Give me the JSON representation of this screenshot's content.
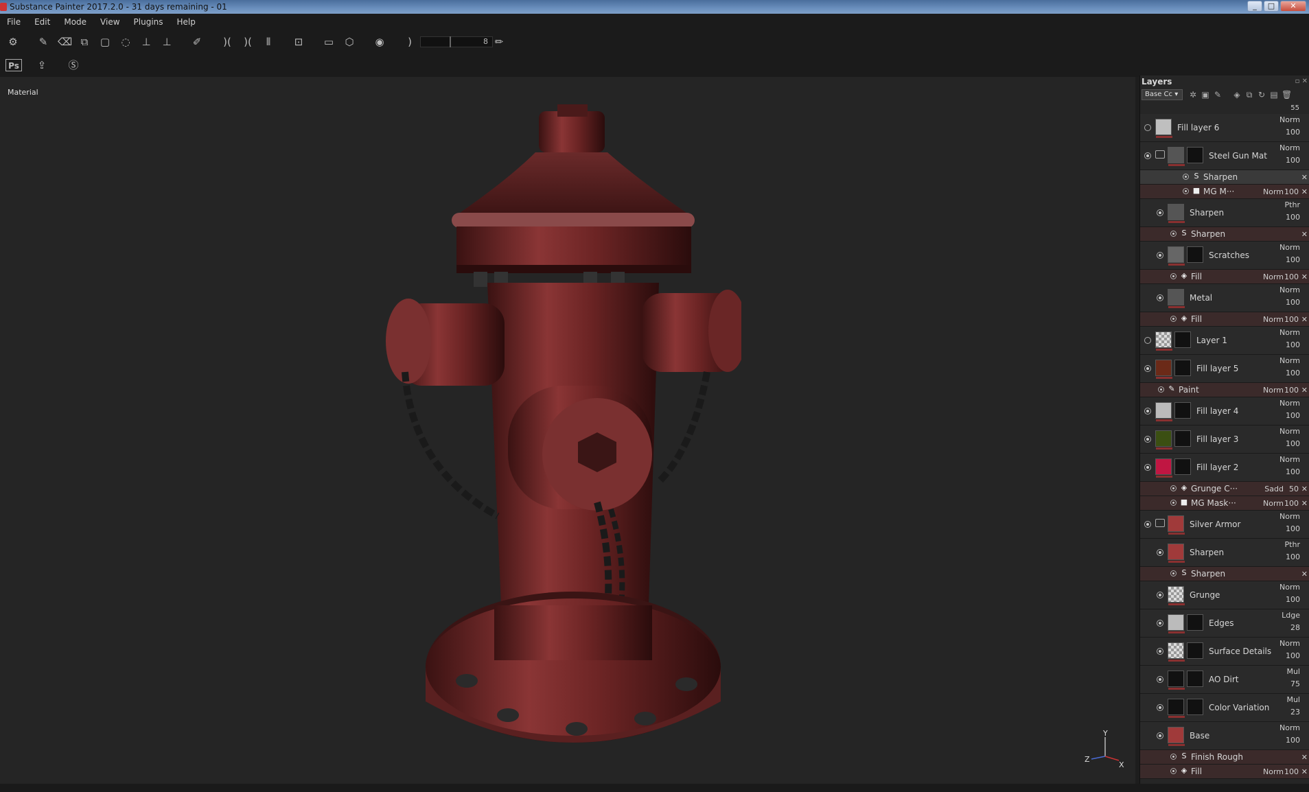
{
  "window": {
    "title": "Substance Painter 2017.2.0 - 31 days remaining - 01",
    "btn_min": "_",
    "btn_max": "□",
    "btn_close": "✕"
  },
  "menu": [
    "File",
    "Edit",
    "Mode",
    "View",
    "Plugins",
    "Help"
  ],
  "toolbar": {
    "tools": [
      "logo-icon",
      "paint-brush-icon",
      "eraser-icon",
      "projection-icon",
      "polygon-fill-icon",
      "smudge-icon",
      "clone-icon",
      "clone-stamp-icon",
      "color-picker-icon",
      "symmetry-icon",
      "mirror-icon",
      "mirror-x-icon",
      "camera-icon",
      "video-icon",
      "cube-icon",
      "screenshot-icon",
      "brush-stroke-icon"
    ],
    "slider_value": "8",
    "row2": [
      "photoshop-icon",
      "export-icon",
      "substance-icon"
    ],
    "photoshop_label": "Ps"
  },
  "viewport": {
    "label": "Material",
    "axis_y": "Y",
    "axis_z": "Z",
    "axis_x": "X"
  },
  "panel": {
    "title": "Layers",
    "controls": "▫ ✕",
    "channel": "Base Cc",
    "channel_arrow": "▾",
    "top_value": "55"
  },
  "layers": [
    {
      "kind": "layer",
      "name": "Fill layer 6",
      "blend": "Norm",
      "opacity": "100",
      "visible": false,
      "indent": 0,
      "thumb": "#bfbfbf",
      "mask": false
    },
    {
      "kind": "folder",
      "name": "Steel Gun Mat",
      "blend": "Norm",
      "opacity": "100",
      "visible": true,
      "indent": 0,
      "thumb": "#555",
      "mask": true
    },
    {
      "kind": "effect",
      "name": "Sharpen",
      "blend": "",
      "opacity": "",
      "visible": true,
      "indent": 2,
      "icon": "S",
      "selected": true
    },
    {
      "kind": "effect",
      "name": "MG M···",
      "blend": "Norm",
      "opacity": "100",
      "visible": true,
      "indent": 2,
      "icon": "■",
      "red": true
    },
    {
      "kind": "layer",
      "name": "Sharpen",
      "blend": "Pthr",
      "opacity": "100",
      "visible": true,
      "indent": 1,
      "thumb": "#555",
      "mask": false
    },
    {
      "kind": "effect",
      "name": "Sharpen",
      "blend": "",
      "opacity": "",
      "visible": true,
      "indent": 1,
      "icon": "S",
      "red": true
    },
    {
      "kind": "layer",
      "name": "Scratches",
      "blend": "Norm",
      "opacity": "100",
      "visible": true,
      "indent": 1,
      "thumb": "#666",
      "mask": true
    },
    {
      "kind": "effect",
      "name": "Fill",
      "blend": "Norm",
      "opacity": "100",
      "visible": true,
      "indent": 1,
      "icon": "◈",
      "red": true
    },
    {
      "kind": "layer",
      "name": "Metal",
      "blend": "Norm",
      "opacity": "100",
      "visible": true,
      "indent": 1,
      "thumb": "#555",
      "mask": false
    },
    {
      "kind": "effect",
      "name": "Fill",
      "blend": "Norm",
      "opacity": "100",
      "visible": true,
      "indent": 1,
      "icon": "◈",
      "red": true
    },
    {
      "kind": "layer",
      "name": "Layer 1",
      "blend": "Norm",
      "opacity": "100",
      "visible": false,
      "indent": 0,
      "thumb": "checker",
      "mask": true
    },
    {
      "kind": "layer",
      "name": "Fill layer 5",
      "blend": "Norm",
      "opacity": "100",
      "visible": true,
      "indent": 0,
      "thumb": "#6b2a18",
      "mask": true
    },
    {
      "kind": "effect",
      "name": "Paint",
      "blend": "Norm",
      "opacity": "100",
      "visible": true,
      "indent": 0,
      "icon": "✎",
      "red": true
    },
    {
      "kind": "layer",
      "name": "Fill layer 4",
      "blend": "Norm",
      "opacity": "100",
      "visible": true,
      "indent": 0,
      "thumb": "#bbbbbb",
      "mask": true
    },
    {
      "kind": "layer",
      "name": "Fill layer 3",
      "blend": "Norm",
      "opacity": "100",
      "visible": true,
      "indent": 0,
      "thumb": "#3b4f12",
      "mask": true
    },
    {
      "kind": "layer",
      "name": "Fill layer 2",
      "blend": "Norm",
      "opacity": "100",
      "visible": true,
      "indent": 0,
      "thumb": "#c01642",
      "mask": true
    },
    {
      "kind": "effect",
      "name": "Grunge C···",
      "blend": "Sadd",
      "opacity": "50",
      "visible": true,
      "indent": 1,
      "icon": "◈",
      "red": true
    },
    {
      "kind": "effect",
      "name": "MG Mask···",
      "blend": "Norm",
      "opacity": "100",
      "visible": true,
      "indent": 1,
      "icon": "■",
      "red": true
    },
    {
      "kind": "folder",
      "name": "Silver Armor",
      "blend": "Norm",
      "opacity": "100",
      "visible": true,
      "indent": 0,
      "thumb": "#a03a3a",
      "mask": false
    },
    {
      "kind": "layer",
      "name": "Sharpen",
      "blend": "Pthr",
      "opacity": "100",
      "visible": true,
      "indent": 1,
      "thumb": "#a03a3a",
      "mask": false
    },
    {
      "kind": "effect",
      "name": "Sharpen",
      "blend": "",
      "opacity": "",
      "visible": true,
      "indent": 1,
      "icon": "S",
      "red": true
    },
    {
      "kind": "layer",
      "name": "Grunge",
      "blend": "Norm",
      "opacity": "100",
      "visible": true,
      "indent": 1,
      "thumb": "checker",
      "mask": false
    },
    {
      "kind": "layer",
      "name": "Edges",
      "blend": "Ldge",
      "opacity": "28",
      "visible": true,
      "indent": 1,
      "thumb": "#bbbbbb",
      "mask": true
    },
    {
      "kind": "layer",
      "name": "Surface Details",
      "blend": "Norm",
      "opacity": "100",
      "visible": true,
      "indent": 1,
      "thumb": "checker",
      "mask": true
    },
    {
      "kind": "layer",
      "name": "AO Dirt",
      "blend": "Mul",
      "opacity": "75",
      "visible": true,
      "indent": 1,
      "thumb": "#111",
      "mask": true
    },
    {
      "kind": "layer",
      "name": "Color Variation",
      "blend": "Mul",
      "opacity": "23",
      "visible": true,
      "indent": 1,
      "thumb": "#111",
      "mask": true
    },
    {
      "kind": "layer",
      "name": "Base",
      "blend": "Norm",
      "opacity": "100",
      "visible": true,
      "indent": 1,
      "thumb": "#a03a3a",
      "mask": false
    },
    {
      "kind": "effect",
      "name": "Finish Rough",
      "blend": "",
      "opacity": "",
      "visible": true,
      "indent": 1,
      "icon": "S",
      "red": true
    },
    {
      "kind": "effect",
      "name": "Fill",
      "blend": "Norm",
      "opacity": "100",
      "visible": true,
      "indent": 1,
      "icon": "◈",
      "red": true
    }
  ]
}
